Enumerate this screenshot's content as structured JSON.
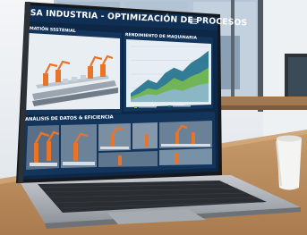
{
  "dashboard": {
    "title": "SA INDUSTRIA - OPTIMIZACIÓN DE PROCESOS",
    "panel_automation": {
      "title": "MATIÓN SSSTENIAL"
    },
    "panel_machinery": {
      "title": "RENDIMIENTO DE MAQUINARIA",
      "chart_data": {
        "type": "area",
        "series": [
          {
            "color": "#1f6f8b",
            "values": [
              10,
              18,
              26,
              22,
              34,
              40,
              36,
              46,
              52,
              60
            ]
          },
          {
            "color": "#7cc04b",
            "values": [
              6,
              10,
              16,
              14,
              20,
              28,
              24,
              30,
              34,
              40
            ]
          },
          {
            "color": "#8fb6d6",
            "values": [
              3,
              6,
              9,
              8,
              12,
              15,
              13,
              17,
              20,
              22
            ]
          }
        ],
        "grid": true,
        "legend": "bottom"
      }
    },
    "panel_analysis": {
      "title": "ANÁLISIS DE DATOS & EFICIENCIA"
    },
    "colors": {
      "screen_bg": "#0d2747",
      "panel_bg": "#13355c",
      "accent_orange": "#e8742a"
    }
  },
  "icons": {
    "menu": "menu-icon"
  }
}
